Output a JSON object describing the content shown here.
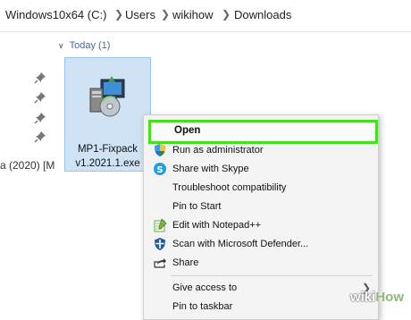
{
  "address_bar": {
    "crumbs": [
      "Windows10x64 (C:)",
      "Users",
      "wikihow",
      "Downloads"
    ]
  },
  "nav": {
    "truncated_item": "a (2020) [M"
  },
  "group": {
    "label": "Today (1)"
  },
  "file": {
    "name_line1": "MP1-Fixpack",
    "name_line2": "v1.2021.1.exe"
  },
  "context_menu": {
    "items": [
      {
        "label": "Open",
        "icon": "none"
      },
      {
        "label": "Run as administrator",
        "icon": "uac-shield-icon"
      },
      {
        "label": "Share with Skype",
        "icon": "skype-icon"
      },
      {
        "label": "Troubleshoot compatibility",
        "icon": "none"
      },
      {
        "label": "Pin to Start",
        "icon": "none"
      },
      {
        "label": "Edit with Notepad++",
        "icon": "notepadpp-icon"
      },
      {
        "label": "Scan with Microsoft Defender...",
        "icon": "defender-icon"
      },
      {
        "label": "Share",
        "icon": "share-icon"
      },
      {
        "label": "Give access to",
        "icon": "none"
      },
      {
        "label": "Pin to taskbar",
        "icon": "none"
      }
    ]
  },
  "colors": {
    "highlight": "#43e01f",
    "selection": "#cfe3f5"
  },
  "watermark": {
    "part1": "wiki",
    "part2": "How"
  }
}
